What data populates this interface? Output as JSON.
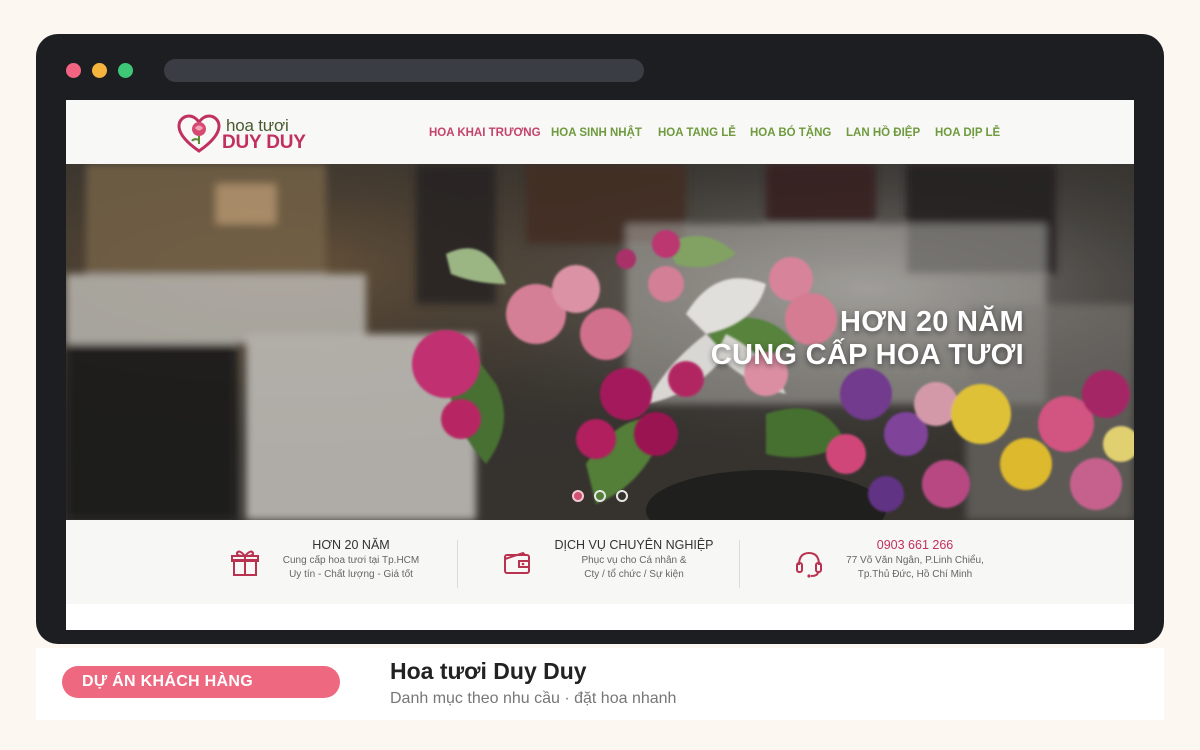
{
  "window": {
    "traffic_lights": [
      "close",
      "minimize",
      "maximize"
    ],
    "colors": {
      "close": "#f36482",
      "minimize": "#f5b43e",
      "maximize": "#3ec776"
    }
  },
  "site": {
    "logo": {
      "line1": "hoa tươi",
      "line2": "DUY DUY",
      "icon": "rose-heart-icon"
    },
    "nav": [
      {
        "label": "HOA KHAI TRƯƠNG",
        "active": true
      },
      {
        "label": "HOA SINH NHẬT",
        "active": false
      },
      {
        "label": "HOA TANG LỄ",
        "active": false
      },
      {
        "label": "HOA BÓ TẶNG",
        "active": false
      },
      {
        "label": "LAN HỒ ĐIỆP",
        "active": false
      },
      {
        "label": "HOA DỊP LỄ",
        "active": false
      }
    ],
    "hero": {
      "line1": "HƠN 20 NĂM",
      "line2": "CUNG CẤP HOA TƯƠI",
      "slides": 3,
      "active_slide": 1
    },
    "features": [
      {
        "icon": "gift-icon",
        "title": "HƠN 20 NĂM",
        "line1": "Cung cấp hoa tươi tại Tp.HCM",
        "line2": "Uy tín - Chất lượng - Giá tốt"
      },
      {
        "icon": "wallet-icon",
        "title": "DỊCH VỤ CHUYÊN NGHIỆP",
        "line1": "Phục vụ cho Cá nhân &",
        "line2": "Cty / tổ chức / Sự kiện"
      },
      {
        "icon": "headset-icon",
        "title": "0903 661 266",
        "line1": "77 Võ Văn Ngân, P.Linh Chiểu,",
        "line2": "Tp.Thủ Đức, Hồ Chí Minh"
      }
    ],
    "colors": {
      "brand": "#c2305f",
      "nav_green": "#6f9b3e"
    }
  },
  "caption": {
    "tag": "DỰ ÁN KHÁCH HÀNG",
    "title": "Hoa tươi Duy Duy",
    "subtitle": "Danh mục theo nhu cầu · đặt hoa nhanh",
    "tag_color": "#ee6880"
  }
}
